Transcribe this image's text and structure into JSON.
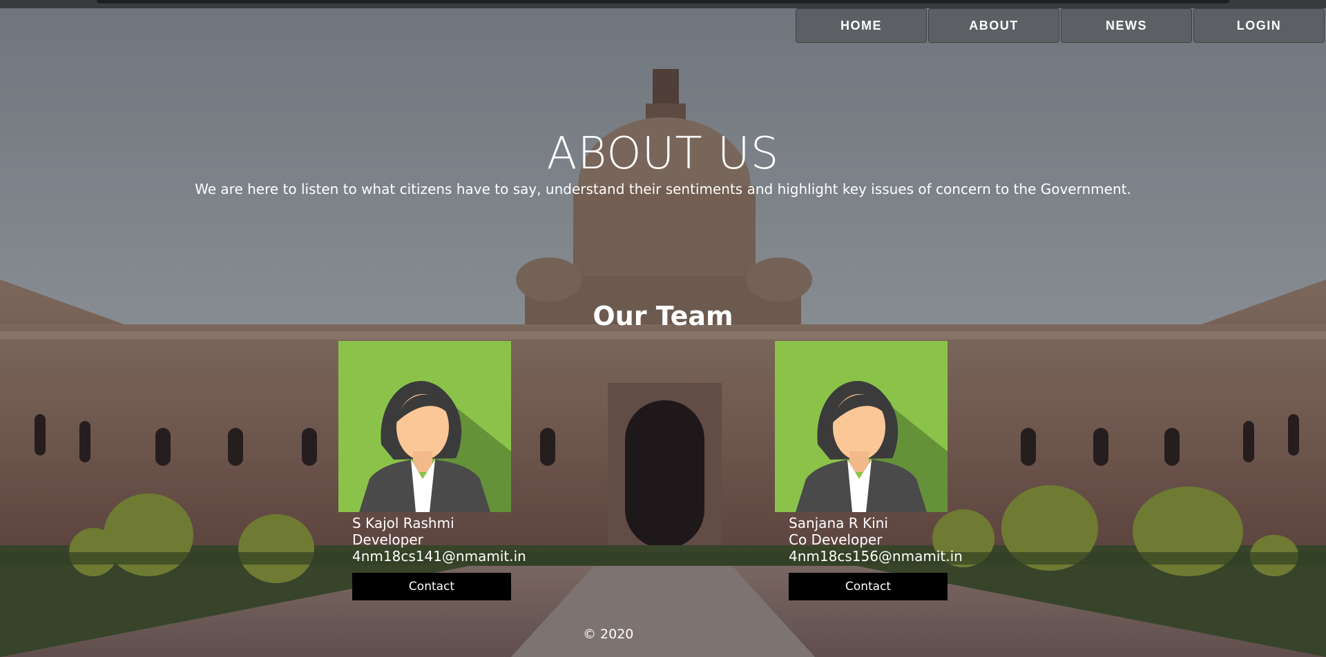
{
  "nav": {
    "items": [
      {
        "label": "HOME"
      },
      {
        "label": "ABOUT"
      },
      {
        "label": "NEWS"
      },
      {
        "label": "LOGIN"
      }
    ]
  },
  "hero": {
    "title": "ABOUT US",
    "subtitle": "We are here to listen to what citizens have to say, understand their sentiments and highlight key issues of concern to the Government."
  },
  "team": {
    "heading": "Our Team",
    "members": [
      {
        "name": "S Kajol Rashmi",
        "role": "Developer",
        "email": "4nm18cs141@nmamit.in",
        "button": "Contact",
        "avatar": "female-avatar-icon"
      },
      {
        "name": "Sanjana R Kini",
        "role": "Co Developer",
        "email": "4nm18cs156@nmamit.in",
        "button": "Contact",
        "avatar": "female-avatar-icon"
      }
    ]
  },
  "footer": {
    "copyright": "© 2020"
  },
  "colors": {
    "avatar_bg": "#8bc34a",
    "nav_bg": "#5a5e62",
    "button_bg": "#000000"
  }
}
